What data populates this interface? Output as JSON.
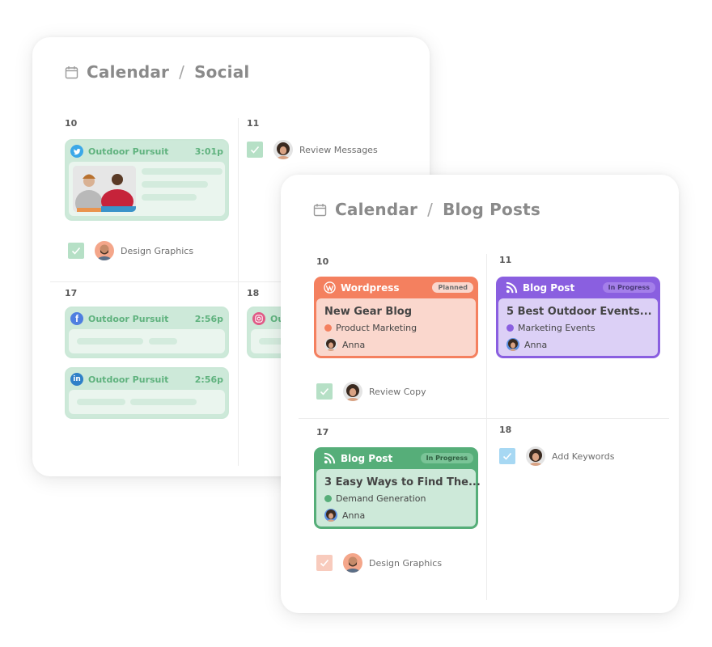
{
  "social_calendar": {
    "title": {
      "section": "Calendar",
      "separator": "/",
      "page": "Social"
    },
    "days": [
      {
        "date": "10",
        "posts": [
          {
            "network": "twitter",
            "network_color": "#3ba8e8",
            "name": "Outdoor Pursuit",
            "time": "3:01p",
            "has_image": true
          }
        ],
        "tasks": [
          {
            "label": "Design Graphics",
            "checkbox_color": "#b6e0c6",
            "assignee": "bearded-man"
          }
        ]
      },
      {
        "date": "11",
        "posts": [],
        "tasks": [
          {
            "label": "Review Messages",
            "checkbox_color": "#b6e0c6",
            "assignee": "anna"
          }
        ]
      },
      {
        "date": "17",
        "posts": [
          {
            "network": "facebook",
            "network_color": "#4f7fe0",
            "name": "Outdoor Pursuit",
            "time": "2:56p",
            "has_image": false
          },
          {
            "network": "linkedin",
            "network_color": "#2f80c8",
            "name": "Outdoor Pursuit",
            "time": "2:56p",
            "has_image": false
          }
        ],
        "tasks": []
      },
      {
        "date": "18",
        "posts": [
          {
            "network": "instagram",
            "network_color": "#e05a86",
            "name": "Outdoor Pursuit",
            "time": "",
            "has_image": false
          }
        ],
        "tasks": []
      }
    ]
  },
  "blog_calendar": {
    "title": {
      "section": "Calendar",
      "separator": "/",
      "page": "Blog Posts"
    },
    "days": [
      {
        "date": "10",
        "posts": [
          {
            "type_icon": "wordpress-icon",
            "type_label": "Wordpress",
            "status": "Planned",
            "title": "New Gear Blog",
            "category": "Product Marketing",
            "owner": "Anna",
            "colors": {
              "frame": "#f4805f",
              "body": "#fad7cd",
              "dot": "#f4805f",
              "badge_bg": "#fad7cd",
              "badge_text": "#6e6e6e"
            }
          }
        ],
        "tasks": [
          {
            "label": "Review Copy",
            "checkbox_color": "#b6e0c6",
            "assignee": "anna"
          }
        ]
      },
      {
        "date": "11",
        "posts": [
          {
            "type_icon": "rss-icon",
            "type_label": "Blog Post",
            "status": "In Progress",
            "title": "5 Best Outdoor Events...",
            "category": "Marketing Events",
            "owner": "Anna",
            "colors": {
              "frame": "#8a5fe0",
              "body": "#dcd0f6",
              "dot": "#8a5fe0",
              "badge_bg": "#a47fea",
              "badge_text": "#4a3a78"
            }
          }
        ],
        "tasks": []
      },
      {
        "date": "17",
        "posts": [
          {
            "type_icon": "rss-icon",
            "type_label": "Blog Post",
            "status": "In Progress",
            "title": "3 Easy Ways to Find The...",
            "category": "Demand Generation",
            "owner": "Anna",
            "colors": {
              "frame": "#56ae79",
              "body": "#cde9d9",
              "dot": "#56ae79",
              "badge_bg": "#7ac497",
              "badge_text": "#2f5e40"
            }
          }
        ],
        "tasks": [
          {
            "label": "Design Graphics",
            "checkbox_color": "#f8cbbd",
            "assignee": "bearded-man"
          }
        ]
      },
      {
        "date": "18",
        "posts": [],
        "tasks": [
          {
            "label": "Add Keywords",
            "checkbox_color": "#a7d8f3",
            "assignee": "anna"
          }
        ]
      }
    ]
  }
}
